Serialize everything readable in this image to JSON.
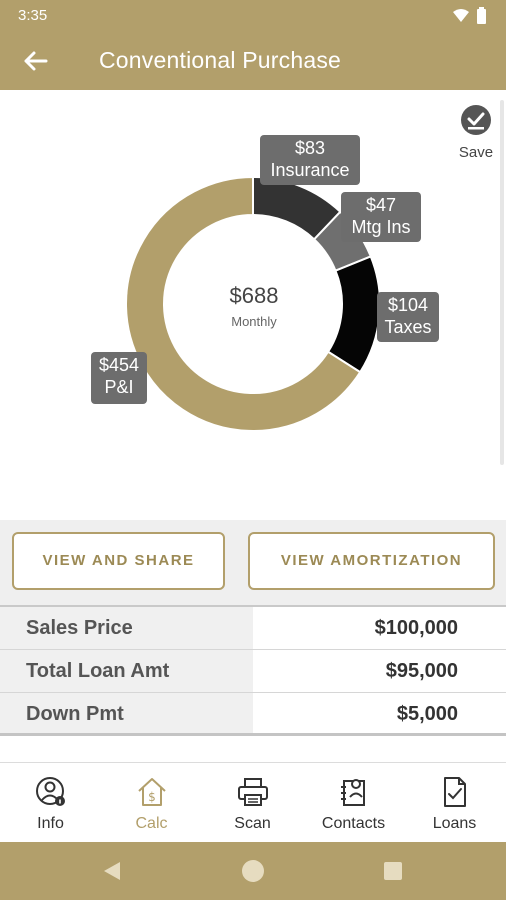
{
  "status_bar": {
    "time": "3:35"
  },
  "app_bar": {
    "title": "Conventional Purchase"
  },
  "save": {
    "label": "Save"
  },
  "donut": {
    "center_value": "$688",
    "center_label": "Monthly",
    "slices": [
      {
        "name": "Insurance",
        "amount": "$83",
        "value": 83,
        "color": "#333333"
      },
      {
        "name": "Mtg Ins",
        "amount": "$47",
        "value": 47,
        "color": "#6f6f6f"
      },
      {
        "name": "Taxes",
        "amount": "$104",
        "value": 104,
        "color": "#050505"
      },
      {
        "name": "P&I",
        "amount": "$454",
        "value": 454,
        "color": "#b29f6b"
      }
    ]
  },
  "buttons": {
    "view_share": "VIEW AND SHARE",
    "view_amortization": "VIEW AMORTIZATION"
  },
  "loan_table": [
    {
      "label": "Sales Price",
      "value": "$100,000"
    },
    {
      "label": "Total Loan Amt",
      "value": "$95,000"
    },
    {
      "label": "Down Pmt",
      "value": "$5,000"
    }
  ],
  "bottom_nav": {
    "items": [
      {
        "label": "Info",
        "icon": "info-user-icon",
        "active": false
      },
      {
        "label": "Calc",
        "icon": "house-dollar-icon",
        "active": true
      },
      {
        "label": "Scan",
        "icon": "printer-icon",
        "active": false
      },
      {
        "label": "Contacts",
        "icon": "contacts-icon",
        "active": false
      },
      {
        "label": "Loans",
        "icon": "document-check-icon",
        "active": false
      }
    ]
  },
  "colors": {
    "brand": "#b29f6b",
    "label_bg": "#6d6d6d"
  }
}
